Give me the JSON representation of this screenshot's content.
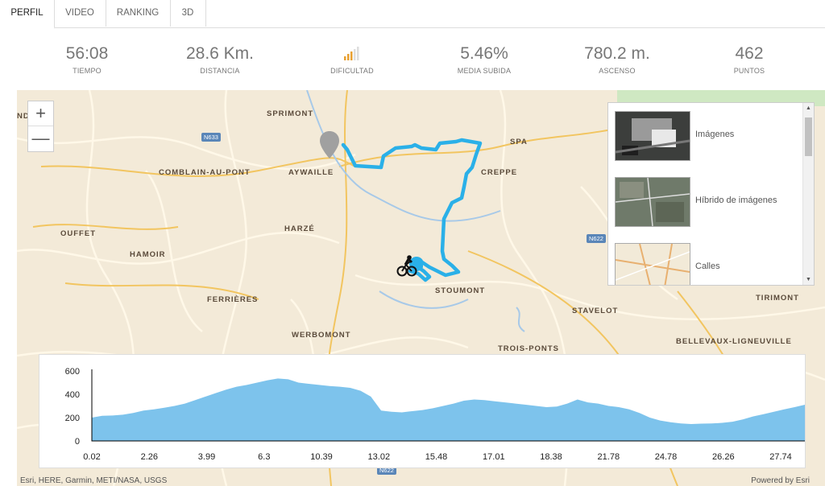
{
  "tabs": [
    {
      "label": "PERFIL"
    },
    {
      "label": "VIDEO"
    },
    {
      "label": "RANKING"
    },
    {
      "label": "3D"
    }
  ],
  "stats": {
    "tiempo": {
      "value": "56:08",
      "label": "TIEMPO"
    },
    "distancia": {
      "value": "28.6 Km.",
      "label": "DISTANCIA"
    },
    "dificultad": {
      "label": "DIFICULTAD",
      "icon": "difficulty-bars-icon",
      "color": "#e8a030"
    },
    "media": {
      "value": "5.46%",
      "label": "MEDIA SUBIDA"
    },
    "ascenso": {
      "value": "780.2 m.",
      "label": "ASCENSO"
    },
    "puntos": {
      "value": "462",
      "label": "PUNTOS"
    }
  },
  "map": {
    "zoom_in": "+",
    "zoom_out": "—",
    "towns": [
      "SPRIMONT",
      "SPA",
      "AYWAILLE",
      "COMBLAIN-AU-PONT",
      "CREPPE",
      "OUFFET",
      "HARZÉ",
      "HAMOIR",
      "STOUMONT",
      "FERRIÈRES",
      "STAVELOT",
      "TIRIMONT",
      "WERBOMONT",
      "TROIS-PONTS",
      "BELLEVAUX-LIGNEUVILLE",
      "ND"
    ],
    "roads": [
      "N633",
      "N622",
      "N622"
    ],
    "route_color": "#2ab0e8",
    "attribution_left": "Esri, HERE, Garmin, METI/NASA, USGS",
    "attribution_right": "Powered by Esri"
  },
  "basemaps": [
    {
      "label": "Imágenes"
    },
    {
      "label": "Híbrido de imágenes"
    },
    {
      "label": "Calles"
    }
  ],
  "chart_data": {
    "type": "area",
    "x_tick_labels": [
      "0.02",
      "2.26",
      "3.99",
      "6.3",
      "10.39",
      "13.02",
      "15.48",
      "17.01",
      "18.38",
      "21.78",
      "24.78",
      "26.26",
      "27.74"
    ],
    "y_ticks": [
      0,
      200,
      400,
      600
    ],
    "ylim": [
      0,
      600
    ],
    "fill_color": "#7dc3ec",
    "values": [
      200,
      215,
      218,
      225,
      240,
      260,
      270,
      285,
      300,
      320,
      350,
      380,
      410,
      440,
      465,
      480,
      500,
      520,
      535,
      528,
      500,
      490,
      480,
      470,
      465,
      455,
      430,
      380,
      260,
      250,
      245,
      255,
      265,
      280,
      300,
      320,
      345,
      355,
      350,
      340,
      330,
      320,
      310,
      300,
      290,
      295,
      320,
      355,
      330,
      320,
      300,
      290,
      270,
      240,
      200,
      175,
      160,
      150,
      145,
      148,
      150,
      155,
      165,
      185,
      210,
      230,
      250,
      270,
      290,
      310
    ]
  }
}
